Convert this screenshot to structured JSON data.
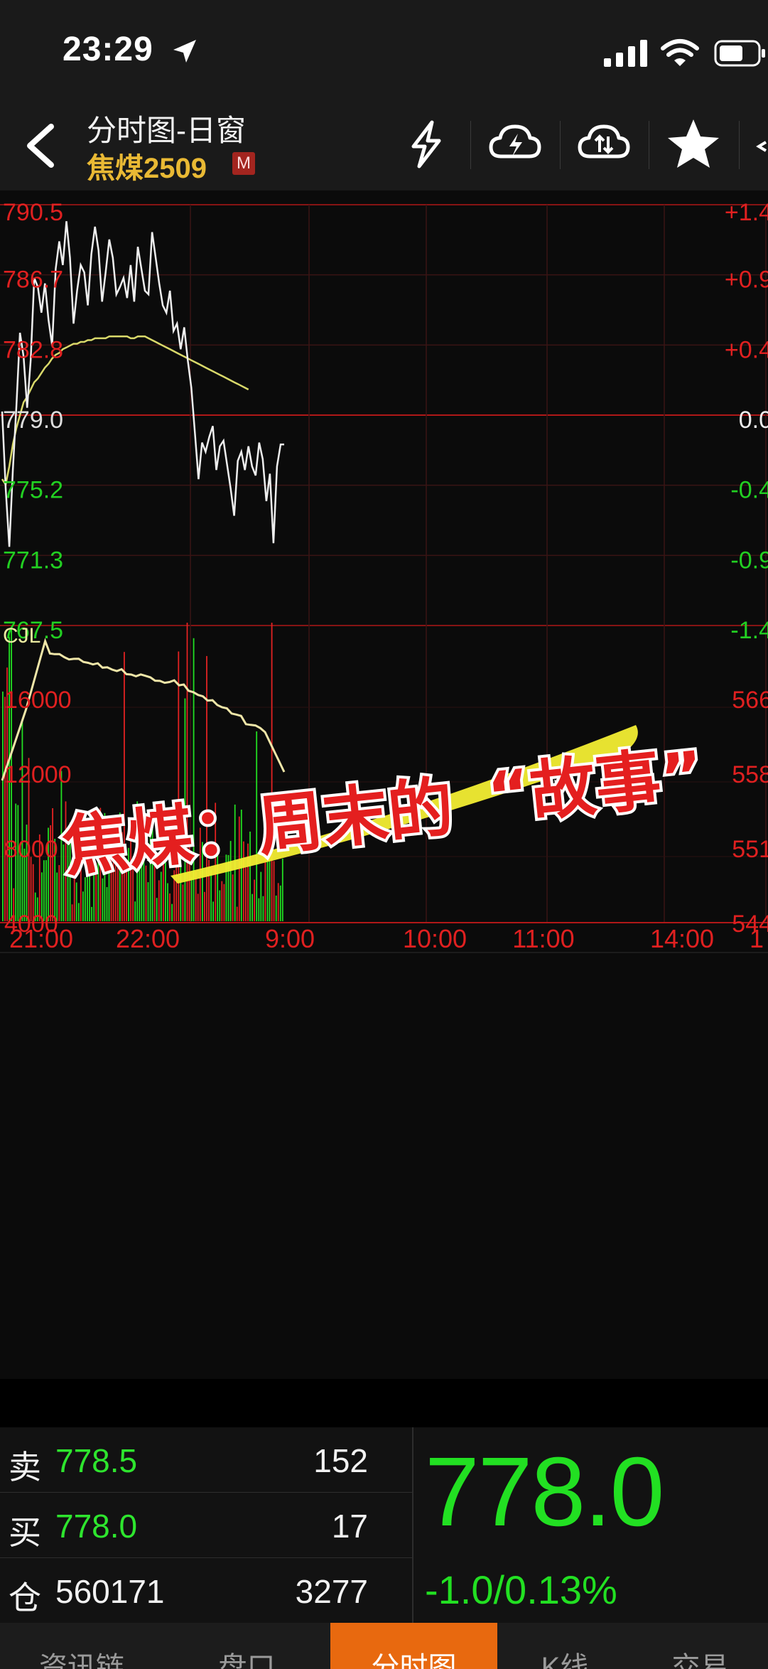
{
  "status_bar": {
    "time": "23:29"
  },
  "header": {
    "title": "分时图-日窗",
    "symbol": "焦煤2509",
    "badge": "M"
  },
  "chart_data": {
    "type": "line",
    "price_axis": {
      "left_ticks": [
        "790.5",
        "786.7",
        "782.8",
        "779.0",
        "775.2",
        "771.3",
        "767.5"
      ],
      "right_ticks": [
        "+1.4",
        "+0.9",
        "+0.4",
        "0.0",
        "-0.4",
        "-0.9",
        "-1.4"
      ],
      "ylim": [
        767.5,
        790.5
      ],
      "reference": 779.0
    },
    "series": [
      {
        "name": "price",
        "color": "#eeeeee",
        "values": [
          779.2,
          775.0,
          771.8,
          776.0,
          779.5,
          783.5,
          782.2,
          779.4,
          782.0,
          786.5,
          786.0,
          784.6,
          786.2,
          784.2,
          782.8,
          787.0,
          788.5,
          787.2,
          789.6,
          787.6,
          784.0,
          785.8,
          787.2,
          786.8,
          785.0,
          787.8,
          789.3,
          788.0,
          785.2,
          786.8,
          788.6,
          787.6,
          785.6,
          786.0,
          786.5,
          785.4,
          787.2,
          785.2,
          788.2,
          787.0,
          785.8,
          785.6,
          789.0,
          787.6,
          786.2,
          785.0,
          784.6,
          785.8,
          783.6,
          784.0,
          782.6,
          783.8,
          782.0,
          780.5,
          778.0,
          775.5,
          777.5,
          777.0,
          777.8,
          778.4,
          776.0,
          777.3,
          777.6,
          776.3,
          775.0,
          773.5,
          776.5,
          777.0,
          776.0,
          777.3,
          776.2,
          775.7,
          777.5,
          776.6,
          774.3,
          775.8,
          772.0,
          776.2,
          777.4,
          777.4
        ]
      },
      {
        "name": "avg",
        "color": "#d9d96a",
        "values": [
          775.5,
          775.2,
          776.2,
          777.4,
          778.3,
          779.0,
          779.7,
          780.0,
          780.4,
          780.8,
          781.0,
          781.3,
          781.6,
          781.8,
          782.1,
          782.3,
          782.4,
          782.6,
          782.7,
          782.8,
          782.9,
          782.9,
          783.0,
          783.0,
          783.1,
          783.1,
          783.2,
          783.2,
          783.2,
          783.2,
          783.3,
          783.3,
          783.3,
          783.3,
          783.3,
          783.3,
          783.2,
          783.2,
          783.3,
          783.3,
          783.3,
          783.2,
          783.1,
          783.0,
          782.9,
          782.8,
          782.7,
          782.6,
          782.5,
          782.4,
          782.3,
          782.2,
          782.1,
          782.0,
          781.9,
          781.8,
          781.7,
          781.6,
          781.5,
          781.4,
          781.3,
          781.2,
          781.1,
          781.0,
          780.9,
          780.8,
          780.7,
          780.6,
          780.5,
          780.4
        ]
      }
    ],
    "volume_axis": {
      "label": "CJL",
      "left_ticks": [
        "16000",
        "12000",
        "8000",
        "4000"
      ],
      "right_ticks": [
        "566",
        "558",
        "551",
        "544"
      ]
    },
    "time_labels": [
      "21:00",
      "22:00",
      "9:00",
      "10:00",
      "11:00",
      "14:00",
      "1"
    ]
  },
  "overlay": {
    "text_main": "焦煤：周末的",
    "text_quoted": "“故事”"
  },
  "quote": {
    "sell_label": "卖",
    "sell_price": "778.5",
    "sell_vol": "152",
    "buy_label": "买",
    "buy_price": "778.0",
    "buy_vol": "17",
    "oi_label": "仓",
    "oi_value": "560171",
    "oi_change": "3277",
    "last_price": "778.0",
    "change": "-1.0/0.13%"
  },
  "tabs": [
    {
      "label": "资讯链"
    },
    {
      "label": "盘口"
    },
    {
      "label": "分时图"
    },
    {
      "label": "K线"
    },
    {
      "label": "交易"
    }
  ],
  "colors": {
    "up": "#e02020",
    "down": "#22e022",
    "accent": "#e8690f",
    "symbol": "#e9b934"
  }
}
